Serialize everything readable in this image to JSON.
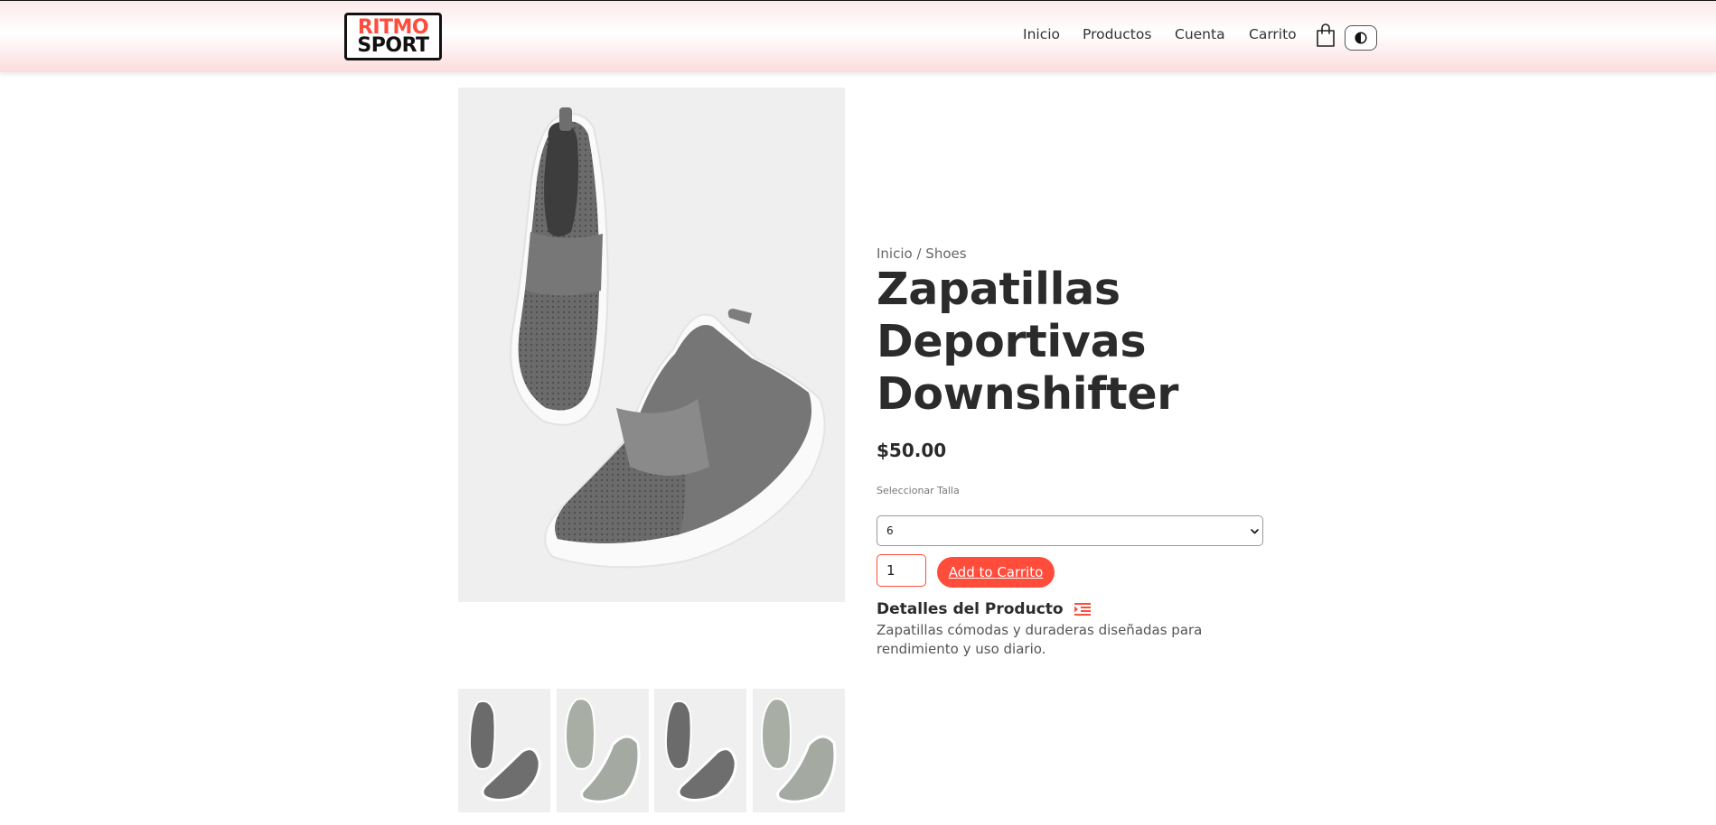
{
  "brand": {
    "line1": "RITMO",
    "line2": "SPORT"
  },
  "nav": {
    "items": [
      {
        "label": "Inicio"
      },
      {
        "label": "Productos"
      },
      {
        "label": "Cuenta"
      },
      {
        "label": "Carrito"
      }
    ],
    "cart_icon": "shopping-bag-icon",
    "theme_icon": "contrast-icon"
  },
  "breadcrumb": {
    "home": "Inicio",
    "separator": " / ",
    "category": "Shoes"
  },
  "product": {
    "title": "Zapatillas Deportivas Downshifter",
    "price": "$50.00",
    "size_label": "Seleccionar Talla",
    "size_selected": "6",
    "quantity": "1",
    "add_button": "Add to Carrito",
    "details_heading": "Detalles del Producto",
    "details_text": "Zapatillas cómodas y duraderas diseñadas para rendimiento y uso diario."
  },
  "colors": {
    "accent": "#ff4c3b",
    "text": "#2b2b2b",
    "image_bg": "#efefef"
  },
  "thumbnails": [
    {
      "icon": "dark-grey-slip-on-shoe"
    },
    {
      "icon": "light-grey-high-top-shoe"
    },
    {
      "icon": "dark-grey-slip-on-shoe"
    },
    {
      "icon": "light-grey-high-top-shoe"
    }
  ]
}
